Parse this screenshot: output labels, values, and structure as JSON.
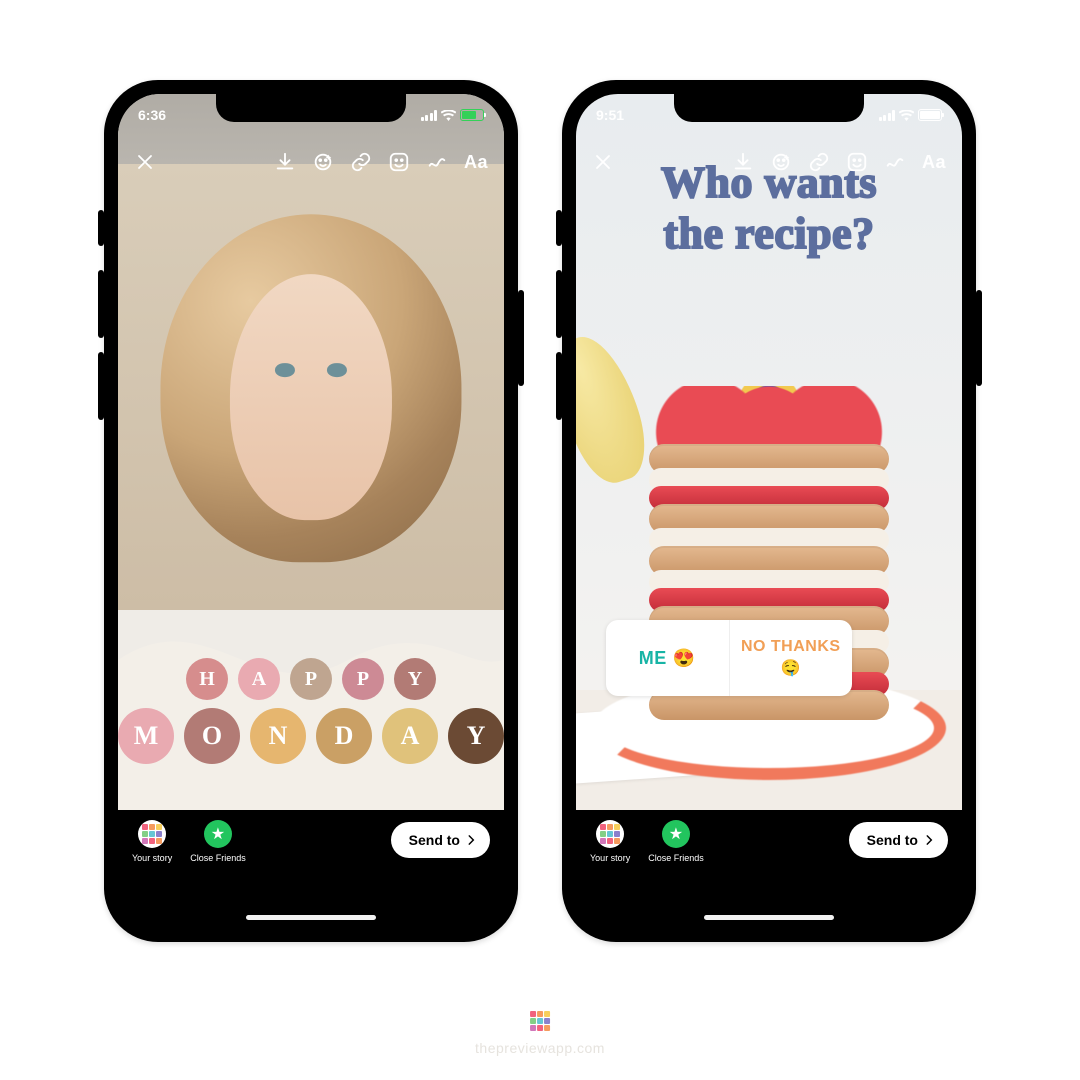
{
  "watermark": {
    "text": "thepreviewapp.com"
  },
  "colors": {
    "headline": "#5c6e9e",
    "poll_left": "#17b4a5",
    "poll_right": "#f19f56",
    "close_friends": "#22c55e"
  },
  "circle_palette": {
    "happy": [
      "#d68d8d",
      "#e9aab1",
      "#bfa590",
      "#cd8a95",
      "#b27b75"
    ],
    "monday": [
      "#e9aab1",
      "#b27b75",
      "#e6b66f",
      "#caa065",
      "#e0c27b",
      "#6b4a34"
    ]
  },
  "phones": [
    {
      "id": "left",
      "status": {
        "time": "6:36",
        "battery_style": "green",
        "battery_fill_pct": 70
      },
      "toolbar": {
        "icons": [
          "download-icon",
          "face-effect-icon",
          "link-icon",
          "sticker-icon",
          "draw-icon"
        ],
        "text_tool": "Aa"
      },
      "story": {
        "text_rows": [
          {
            "word": "HAPPY",
            "palette_key": "happy"
          },
          {
            "word": "MONDAY",
            "palette_key": "monday"
          }
        ]
      },
      "bottombar": {
        "your_story_label": "Your story",
        "close_friends_label": "Close Friends",
        "send_label": "Send to"
      }
    },
    {
      "id": "right",
      "status": {
        "time": "9:51",
        "battery_style": "white",
        "battery_fill_pct": 100
      },
      "toolbar": {
        "icons": [
          "download-icon",
          "face-effect-icon",
          "link-icon",
          "sticker-icon",
          "draw-icon"
        ],
        "text_tool": "Aa"
      },
      "story": {
        "headline_line1": "Who wants",
        "headline_line2": "the recipe?",
        "poll": {
          "left_text": "ME",
          "left_emoji": "😍",
          "right_text": "NO THANKS",
          "right_emoji": "🤤"
        }
      },
      "bottombar": {
        "your_story_label": "Your story",
        "close_friends_label": "Close Friends",
        "send_label": "Send to"
      }
    }
  ]
}
